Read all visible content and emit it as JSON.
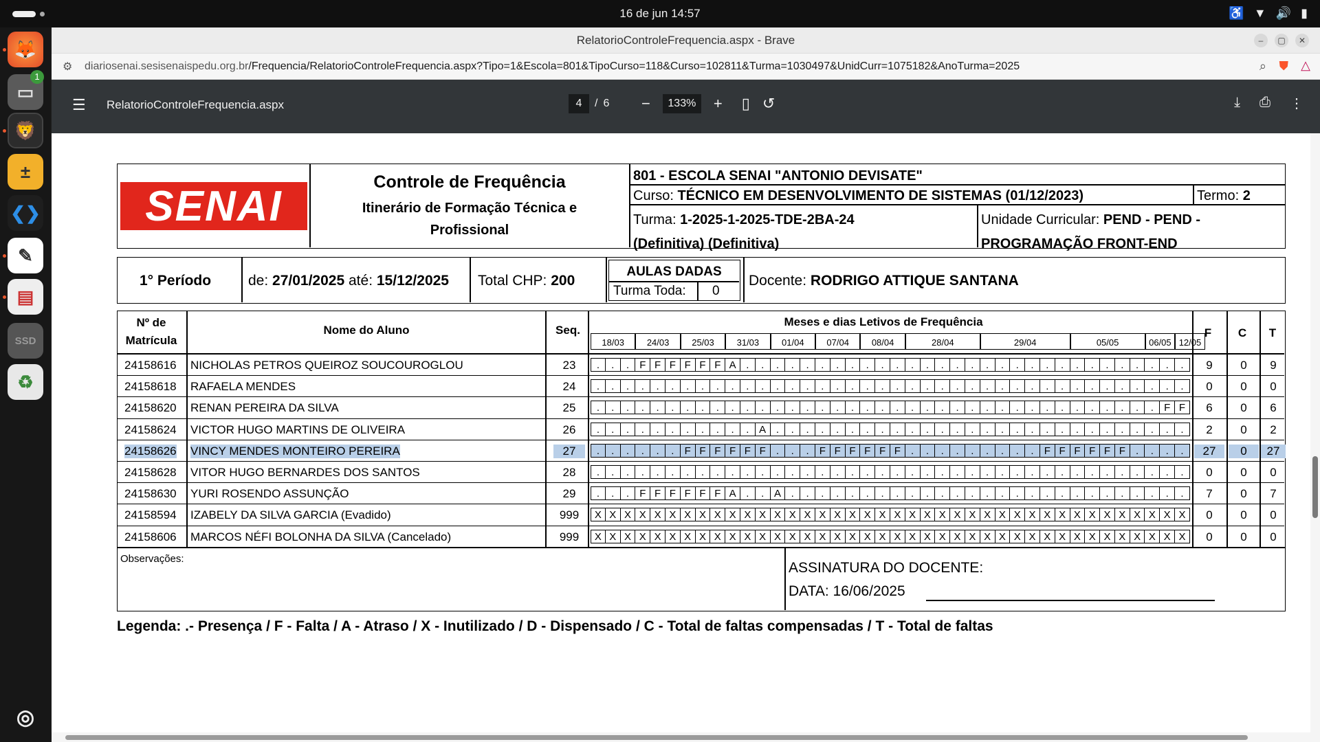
{
  "system": {
    "clock": "16 de jun  14:57",
    "files_badge": "1",
    "ssd_label": "SSD"
  },
  "browser": {
    "title": "RelatorioControleFrequencia.aspx - Brave",
    "url_host": "diariosenai.sesisenaispedu.org.br",
    "url_path": "/Frequencia/RelatorioControleFrequencia.aspx?Tipo=1&Escola=801&TipoCurso=118&Curso=102811&Turma=1030497&UnidCurr=1075182&AnoTurma=2025"
  },
  "pdf": {
    "filename": "RelatorioControleFrequencia.aspx",
    "page": "4",
    "page_sep": "/",
    "total_pages": "6",
    "zoom": "133%"
  },
  "report": {
    "logo_text": "SENAI",
    "title": "Controle de Frequência",
    "subtitle": "Itinerário de Formação Técnica e Profissional",
    "school": "801 - ESCOLA SENAI \"ANTONIO DEVISATE\"",
    "curso_label": "Curso:",
    "curso_value": "TÉCNICO EM DESENVOLVIMENTO DE SISTEMAS (01/12/2023)",
    "termo_label": "Termo:",
    "termo_value": "2",
    "turma_label": "Turma:",
    "turma_value": "1-2025-1-2025-TDE-2BA-24 (Definitiva) (Definitiva)",
    "uc_label": "Unidade Curricular:",
    "uc_value": "PEND - PEND - PROGRAMAÇÃO FRONT-END",
    "periodo": "1° Período",
    "de_label": "de:",
    "de_value": "27/01/2025",
    "ate_label": "até:",
    "ate_value": "15/12/2025",
    "chp_label": "Total CHP:",
    "chp_value": "200",
    "aulas_title": "AULAS DADAS",
    "turma_toda_label": "Turma Toda:",
    "turma_toda_value": "0",
    "docente_label": "Docente:",
    "docente_value": "RODRIGO ATTIQUE SANTANA",
    "col_matricula": "Nº de Matrícula",
    "col_nome": "Nome do Aluno",
    "col_seq": "Seq.",
    "col_meses": "Meses e dias Letivos de Frequência",
    "col_f": "F",
    "col_c": "C",
    "col_t": "T",
    "dates": [
      "18/03",
      "24/03",
      "25/03",
      "31/03",
      "01/04",
      "07/04",
      "08/04",
      "28/04",
      "29/04",
      "05/05",
      "06/05",
      "12/05"
    ],
    "date_spans": [
      3,
      3,
      3,
      3,
      3,
      3,
      3,
      5,
      6,
      5,
      2,
      2
    ],
    "students": [
      {
        "mat": "24158616",
        "nome": "NICHOLAS PETROS QUEIROZ SOUCOUROGLOU",
        "seq": "23",
        "marks": ". . . F F F F F F A . . . . . . . . . . . . . . . . . . . . . . . . . . . . . .",
        "f": "9",
        "c": "0",
        "t": "9",
        "hl": false
      },
      {
        "mat": "24158618",
        "nome": "RAFAELA MENDES",
        "seq": "24",
        "marks": ". . . . . . . . . . . . . . . . . . . . . . . . . . . . . . . . . . . . . . . .",
        "f": "0",
        "c": "0",
        "t": "0",
        "hl": false
      },
      {
        "mat": "24158620",
        "nome": "RENAN PEREIRA DA SILVA",
        "seq": "25",
        "marks": ". . . . . . . . . . . . . . . . . . . . . . . . . . . . . . . . . . . . . . F F",
        "f": "6",
        "c": "0",
        "t": "6",
        "hl": false
      },
      {
        "mat": "24158624",
        "nome": "VICTOR HUGO MARTINS DE OLIVEIRA",
        "seq": "26",
        "marks": ". . . . . . . . . . . A . . . . . . . . . . . . . . . . . . . . . . . . . . . .",
        "f": "2",
        "c": "0",
        "t": "2",
        "hl": false
      },
      {
        "mat": "24158626",
        "nome": "VINCY MENDES MONTEIRO PEREIRA",
        "seq": "27",
        "marks": ". . . . . . F F F F F F . . . F F F F F F . . . . . . . . . F F F F F F . . . .",
        "f": "27",
        "c": "0",
        "t": "27",
        "hl": true
      },
      {
        "mat": "24158628",
        "nome": "VITOR HUGO BERNARDES DOS SANTOS",
        "seq": "28",
        "marks": ". . . . . . . . . . . . . . . . . . . . . . . . . . . . . . . . . . . . . . . .",
        "f": "0",
        "c": "0",
        "t": "0",
        "hl": false
      },
      {
        "mat": "24158630",
        "nome": "YURI ROSENDO ASSUNÇÃO",
        "seq": "29",
        "marks": ". . . F F F F F F A . . A . . . . . . . . . . . . . . . . . . . . . . . . . . .",
        "f": "7",
        "c": "0",
        "t": "7",
        "hl": false
      },
      {
        "mat": "24158594",
        "nome": "IZABELY DA SILVA GARCIA (Evadido)",
        "seq": "999",
        "marks": "X X X X X X X X X X X X X X X X X X X X X X X X X X X X X X X X X X X X X X X X",
        "f": "0",
        "c": "0",
        "t": "0",
        "hl": false
      },
      {
        "mat": "24158606",
        "nome": "MARCOS NÉFI BOLONHA DA SILVA (Cancelado)",
        "seq": "999",
        "marks": "X X X X X X X X X X X X X X X X X X X X X X X X X X X X X X X X X X X X X X X X",
        "f": "0",
        "c": "0",
        "t": "0",
        "hl": false
      }
    ],
    "observacoes_label": "Observações:",
    "assinatura_label": "ASSINATURA DO DOCENTE:",
    "data_label": "DATA: 16/06/2025",
    "legenda": "Legenda: .- Presença / F - Falta / A - Atraso / X - Inutilizado / D - Dispensado / C - Total de faltas compensadas / T - Total de faltas"
  }
}
